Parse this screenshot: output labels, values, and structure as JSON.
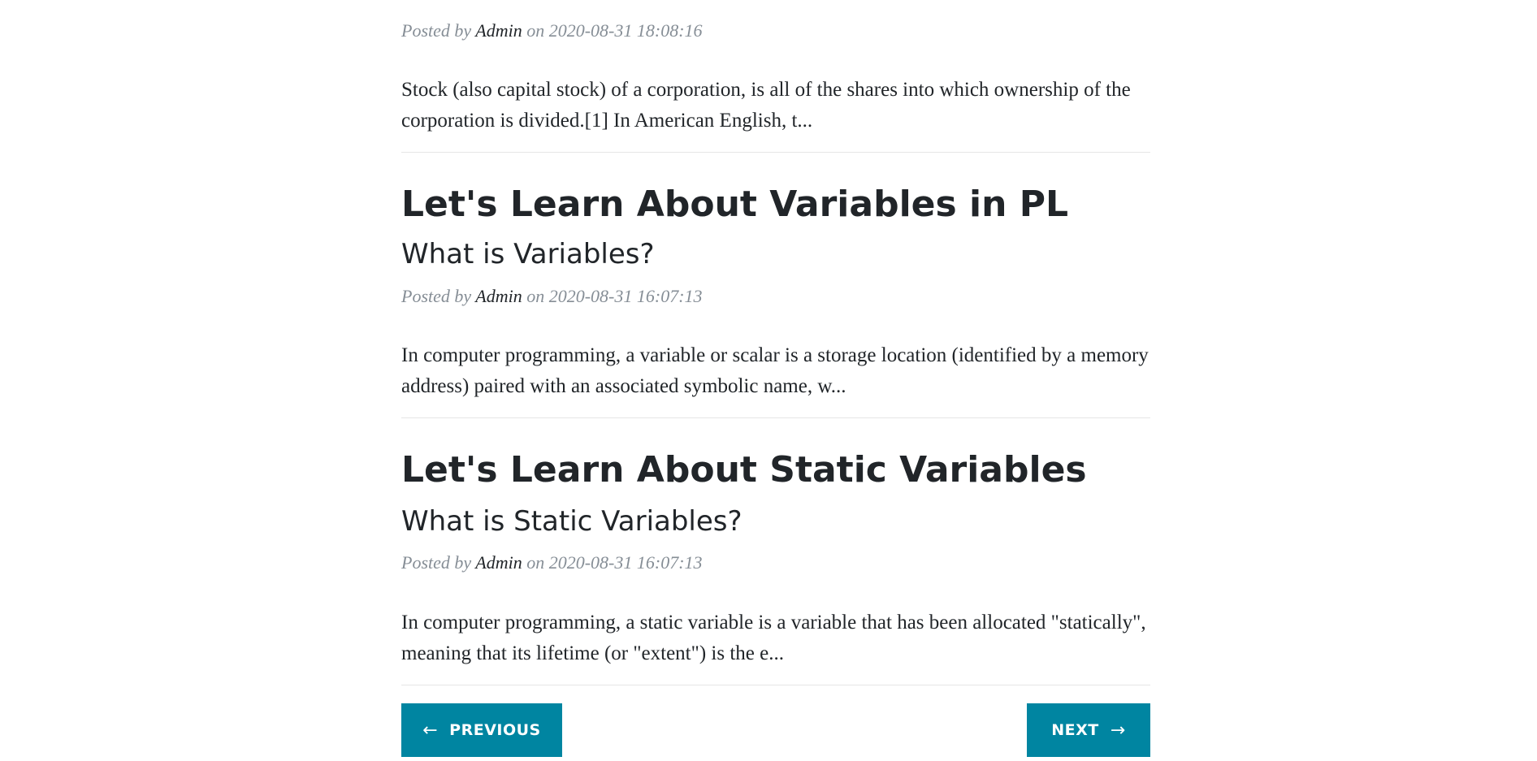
{
  "posts": [
    {
      "meta_prefix": "Posted by",
      "author": "Admin",
      "meta_on": "on",
      "date": "2020-08-31 18:08:16",
      "excerpt": "Stock (also capital stock) of a corporation, is all of the shares into which ownership of the corporation is divided.[1] In American English, t..."
    },
    {
      "title": "Let's Learn About Variables in PL",
      "subtitle": "What is Variables?",
      "meta_prefix": "Posted by",
      "author": "Admin",
      "meta_on": "on",
      "date": "2020-08-31 16:07:13",
      "excerpt": "In computer programming, a variable or scalar is a storage location (identified by a memory address) paired with an associated symbolic name, w..."
    },
    {
      "title": "Let's Learn About Static Variables",
      "subtitle": "What is Static Variables?",
      "meta_prefix": "Posted by",
      "author": "Admin",
      "meta_on": "on",
      "date": "2020-08-31 16:07:13",
      "excerpt": "In computer programming, a static variable is a variable that has been allocated \"statically\", meaning that its lifetime (or \"extent\") is the e..."
    }
  ],
  "pager": {
    "previous_label": "PREVIOUS",
    "previous_arrow": "←",
    "next_label": "NEXT",
    "next_arrow": "→"
  },
  "colors": {
    "button_bg": "#0085a1",
    "meta_text": "#868e96",
    "body_text": "#212529"
  }
}
